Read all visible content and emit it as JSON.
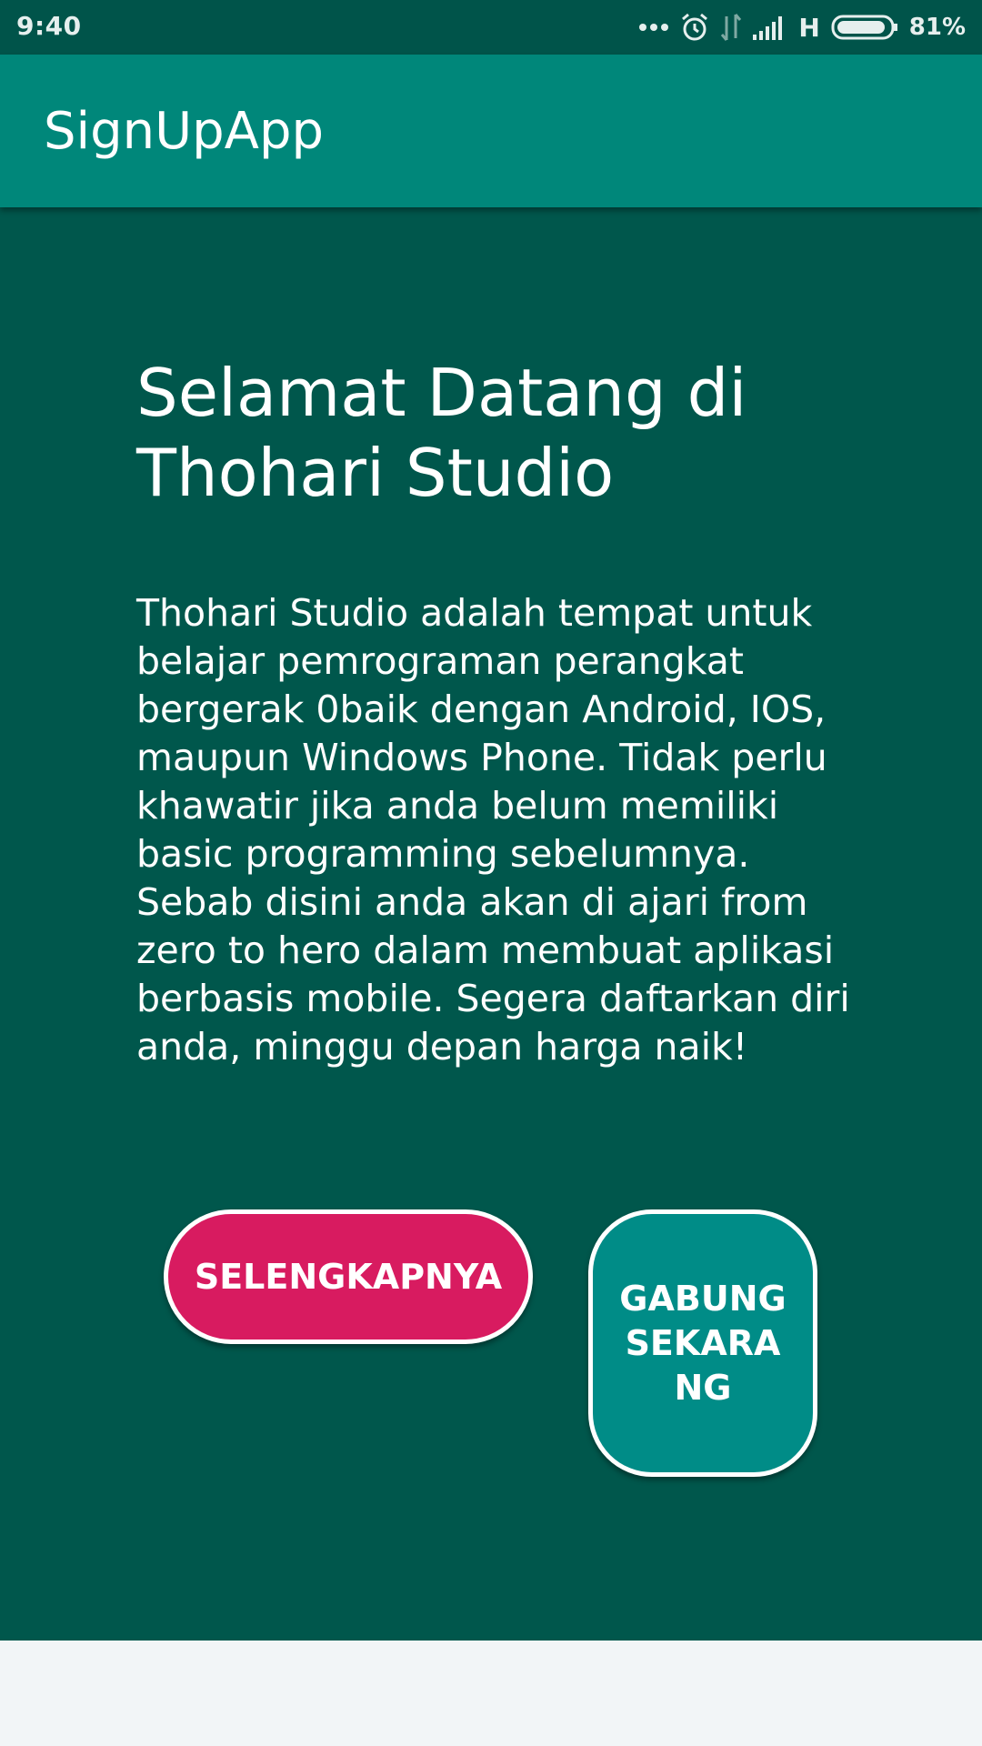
{
  "status_bar": {
    "time": "9:40",
    "icons": [
      "more-dots-icon",
      "alarm-icon",
      "data-arrows-icon",
      "signal-icon"
    ],
    "network": "H",
    "battery_icon": "battery-icon",
    "battery_pct": "81%"
  },
  "app_bar": {
    "title": "SignUpApp",
    "color": "#00877A"
  },
  "main": {
    "background": "#00574C",
    "welcome_title": "Selamat Datang di Thohari Studio",
    "description": "Thohari Studio adalah tempat untuk belajar pemrograman perangkat bergerak 0baik dengan Android, IOS, maupun Windows Phone. Tidak perlu khawatir jika anda belum memiliki basic programming sebelumnya. Sebab disini anda akan di ajari from zero to hero dalam membuat aplikasi berbasis mobile. Segera daftarkan diri anda, minggu depan harga naik!",
    "buttons": {
      "more_label": "SELENGKAPNYA",
      "more_color": "#D81B60",
      "join_label": "GABUNG SEKARANG",
      "join_color": "#008C87"
    }
  }
}
